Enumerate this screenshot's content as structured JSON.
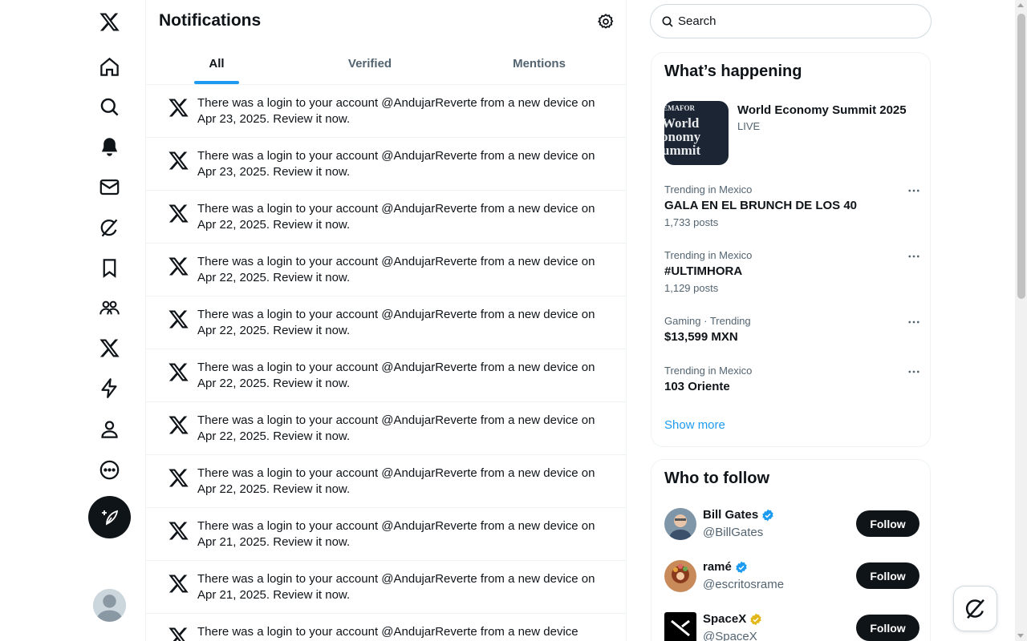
{
  "nav": {
    "items": [
      {
        "name": "x-logo-icon"
      },
      {
        "name": "home-icon"
      },
      {
        "name": "search-icon"
      },
      {
        "name": "bell-icon"
      },
      {
        "name": "mail-icon"
      },
      {
        "name": "grok-icon"
      },
      {
        "name": "bookmark-icon"
      },
      {
        "name": "communities-icon"
      },
      {
        "name": "premium-icon"
      },
      {
        "name": "lightning-icon"
      },
      {
        "name": "profile-icon"
      },
      {
        "name": "more-icon"
      }
    ],
    "compose_icon": "feather-plus-icon"
  },
  "main": {
    "title": "Notifications",
    "tabs": [
      {
        "label": "All",
        "active": true
      },
      {
        "label": "Verified",
        "active": false
      },
      {
        "label": "Mentions",
        "active": false
      }
    ],
    "notifications": [
      {
        "text": "There was a login to your account @AndujarReverte from a new device on Apr 23, 2025. Review it now."
      },
      {
        "text": "There was a login to your account @AndujarReverte from a new device on Apr 23, 2025. Review it now."
      },
      {
        "text": "There was a login to your account @AndujarReverte from a new device on Apr 22, 2025. Review it now."
      },
      {
        "text": "There was a login to your account @AndujarReverte from a new device on Apr 22, 2025. Review it now."
      },
      {
        "text": "There was a login to your account @AndujarReverte from a new device on Apr 22, 2025. Review it now."
      },
      {
        "text": "There was a login to your account @AndujarReverte from a new device on Apr 22, 2025. Review it now."
      },
      {
        "text": "There was a login to your account @AndujarReverte from a new device on Apr 22, 2025. Review it now."
      },
      {
        "text": "There was a login to your account @AndujarReverte from a new device on Apr 22, 2025. Review it now."
      },
      {
        "text": "There was a login to your account @AndujarReverte from a new device on Apr 21, 2025. Review it now."
      },
      {
        "text": "There was a login to your account @AndujarReverte from a new device on Apr 21, 2025. Review it now."
      },
      {
        "text": "There was a login to your account @AndujarReverte from a new device"
      }
    ]
  },
  "right": {
    "search_placeholder": "Search",
    "happening": {
      "title": "What’s happening",
      "event": {
        "title": "World Economy Summit 2025",
        "status": "LIVE",
        "thumb_lines": [
          "EMAFOR",
          "World",
          "onomy",
          "ummit"
        ]
      },
      "trends": [
        {
          "meta": "Trending in Mexico",
          "name": "GALA EN EL BRUNCH DE LOS 40",
          "count": "1,733 posts"
        },
        {
          "meta": "Trending in Mexico",
          "name": "#ULTIMHORA",
          "count": "1,129 posts"
        },
        {
          "meta": "Gaming · Trending",
          "name": "$13,599 MXN",
          "count": ""
        },
        {
          "meta": "Trending in Mexico",
          "name": "103 Oriente",
          "count": ""
        }
      ],
      "show_more": "Show more"
    },
    "follow": {
      "title": "Who to follow",
      "users": [
        {
          "name": "Bill Gates",
          "handle": "@BillGates",
          "badge": "blue",
          "button": "Follow"
        },
        {
          "name": "ramé",
          "handle": "@escritosrame",
          "badge": "blue",
          "button": "Follow"
        },
        {
          "name": "SpaceX",
          "handle": "@SpaceX",
          "badge": "gold",
          "button": "Follow"
        }
      ]
    }
  },
  "colors": {
    "accent": "#1d9bf0",
    "text": "#0f1419",
    "secondary": "#536471",
    "gold": "#e2b719"
  }
}
